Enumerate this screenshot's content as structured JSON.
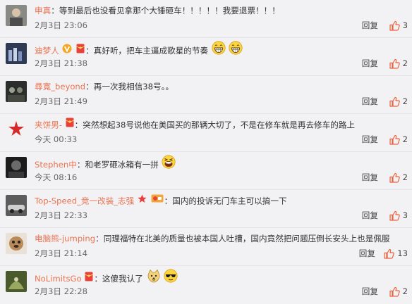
{
  "comments": [
    {
      "user": "申真",
      "text": "：等到最后也没看见拿那个大锤砸车！！！！！我要退票！！！",
      "time": "2月3日 23:06",
      "reply": "回复",
      "likes": "3",
      "badges": [],
      "emojis": []
    },
    {
      "user": "迪梦人",
      "text": "：真好听，把车主逼成歌星的节奏",
      "time": "2月3日 21:38",
      "reply": "回复",
      "likes": "2",
      "badges": [
        "v-badge-icon",
        "red-envelope-badge-icon"
      ],
      "emojis": [
        "grin-emoji-icon",
        "grin-emoji-icon"
      ]
    },
    {
      "user": "尋寬_beyond",
      "text": "：再一次我相信38号。。",
      "time": "2月3日 21:49",
      "reply": "回复",
      "likes": "2",
      "badges": [],
      "emojis": []
    },
    {
      "user": "夹饼男-",
      "text": "：突然想起38号说他在美国买的那辆大切了，不是在修车就是再去修车的路上",
      "time": "今天 00:33",
      "reply": "回复",
      "likes": "2",
      "badges": [
        "red-envelope-badge-icon"
      ],
      "emojis": []
    },
    {
      "user": "Stephen中",
      "text": "：和老罗砸冰箱有一拼",
      "time": "今天 08:16",
      "reply": "回复",
      "likes": "2",
      "badges": [],
      "emojis": [
        "laugh-emoji-icon"
      ]
    },
    {
      "user": "Top-Speed_竞一改装_志强",
      "text": "：国内的投诉无门车主可以搞一下",
      "time": "2月3日 22:33",
      "reply": "回复",
      "likes": "3",
      "badges": [
        "star-badge-icon",
        "fan-badge-icon"
      ],
      "emojis": []
    },
    {
      "user": "电脑熊-jumping",
      "text": "：同理福特在北美的质量也被本国人吐槽，国内竟然把问题压倒长安头上也是佩服",
      "time": "2月3日 21:14",
      "reply": "回复",
      "likes": "13",
      "badges": [],
      "emojis": []
    },
    {
      "user": "NoLimitsGo",
      "text": "：这傻我认了",
      "time": "2月3日 22:28",
      "reply": "回复",
      "likes": "2",
      "badges": [
        "red-envelope-badge-icon"
      ],
      "emojis": [
        "doge-emoji-icon",
        "cool-emoji-icon"
      ]
    }
  ]
}
